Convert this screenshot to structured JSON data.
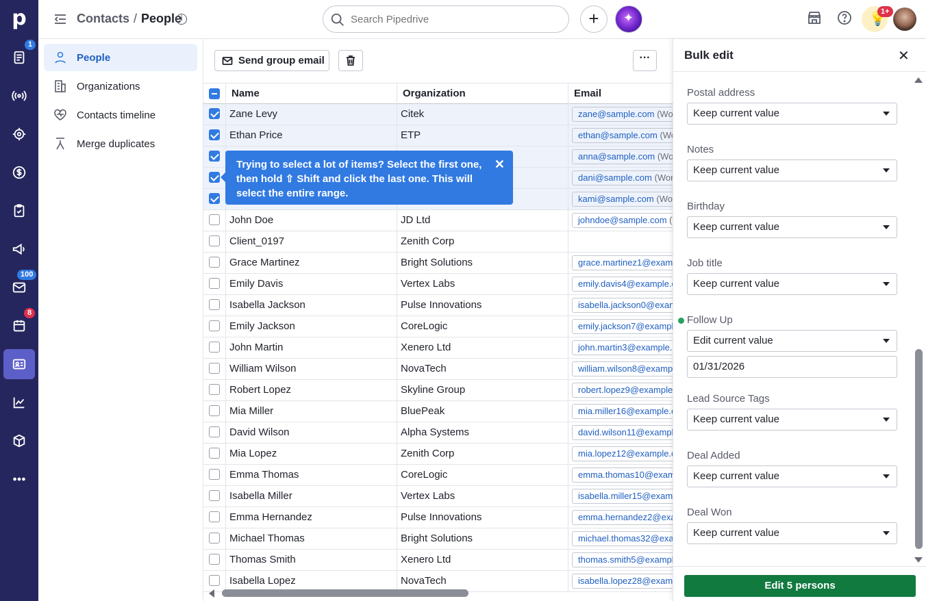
{
  "rail": {
    "logo": "p",
    "badges": {
      "leads": "1",
      "mail": "100",
      "activities": "8"
    }
  },
  "topbar": {
    "breadcrumb_parent": "Contacts",
    "breadcrumb_sep": "/",
    "breadcrumb_current": "People",
    "info_glyph": "i",
    "search_placeholder": "Search Pipedrive",
    "add_glyph": "+",
    "notification_count": "1+"
  },
  "subnav": {
    "items": [
      {
        "label": "People",
        "icon": "person-icon"
      },
      {
        "label": "Organizations",
        "icon": "building-icon"
      },
      {
        "label": "Contacts timeline",
        "icon": "heart-pulse-icon"
      },
      {
        "label": "Merge duplicates",
        "icon": "merge-icon"
      }
    ]
  },
  "toolbar": {
    "send_group_email": "Send group email",
    "more_glyph": "···"
  },
  "table": {
    "columns": [
      "Name",
      "Organization",
      "Email"
    ],
    "rows": [
      {
        "name": "Zane Levy",
        "org": "Citek",
        "email": "zane@sample.com",
        "email_tag": "(Wor",
        "selected": true
      },
      {
        "name": "Ethan Price",
        "org": "ETP",
        "email": "ethan@sample.com",
        "email_tag": "(Wo",
        "selected": true
      },
      {
        "name": "",
        "org": "",
        "email": "anna@sample.com",
        "email_tag": "(Wo",
        "selected": true
      },
      {
        "name": "",
        "org": "",
        "email": "dani@sample.com",
        "email_tag": "(Wor",
        "selected": true
      },
      {
        "name": "",
        "org": "",
        "email": "kami@sample.com",
        "email_tag": "(Wor",
        "selected": true
      },
      {
        "name": "John Doe",
        "org": "JD Ltd",
        "email": "johndoe@sample.com",
        "email_tag": "(V",
        "selected": false
      },
      {
        "name": "Client_0197",
        "org": "Zenith Corp",
        "email": "",
        "email_tag": "",
        "selected": false
      },
      {
        "name": "Grace Martinez",
        "org": "Bright Solutions",
        "email": "grace.martinez1@examp",
        "email_tag": "",
        "selected": false
      },
      {
        "name": "Emily Davis",
        "org": "Vertex Labs",
        "email": "emily.davis4@example.co",
        "email_tag": "",
        "selected": false
      },
      {
        "name": "Isabella Jackson",
        "org": "Pulse Innovations",
        "email": "isabella.jackson0@exam",
        "email_tag": "",
        "selected": false
      },
      {
        "name": "Emily Jackson",
        "org": "CoreLogic",
        "email": "emily.jackson7@example",
        "email_tag": "",
        "selected": false
      },
      {
        "name": "John Martin",
        "org": "Xenero Ltd",
        "email": "john.martin3@example.c",
        "email_tag": "",
        "selected": false
      },
      {
        "name": "William Wilson",
        "org": "NovaTech",
        "email": "william.wilson8@exampl",
        "email_tag": "",
        "selected": false
      },
      {
        "name": "Robert Lopez",
        "org": "Skyline Group",
        "email": "robert.lopez9@example.",
        "email_tag": "",
        "selected": false
      },
      {
        "name": "Mia Miller",
        "org": "BluePeak",
        "email": "mia.miller16@example.co",
        "email_tag": "",
        "selected": false
      },
      {
        "name": "David Wilson",
        "org": "Alpha Systems",
        "email": "david.wilson11@example",
        "email_tag": "",
        "selected": false
      },
      {
        "name": "Mia Lopez",
        "org": "Zenith Corp",
        "email": "mia.lopez12@example.co",
        "email_tag": "",
        "selected": false
      },
      {
        "name": "Emma Thomas",
        "org": "CoreLogic",
        "email": "emma.thomas10@examp",
        "email_tag": "",
        "selected": false
      },
      {
        "name": "Isabella Miller",
        "org": "Vertex Labs",
        "email": "isabella.miller15@examp",
        "email_tag": "",
        "selected": false
      },
      {
        "name": "Emma Hernandez",
        "org": "Pulse Innovations",
        "email": "emma.hernandez2@exa",
        "email_tag": "",
        "selected": false
      },
      {
        "name": "Michael Thomas",
        "org": "Bright Solutions",
        "email": "michael.thomas32@exar",
        "email_tag": "",
        "selected": false
      },
      {
        "name": "Thomas Smith",
        "org": "Xenero Ltd",
        "email": "thomas.smith5@example",
        "email_tag": "",
        "selected": false
      },
      {
        "name": "Isabella Lopez",
        "org": "NovaTech",
        "email": "isabella.lopez28@examp",
        "email_tag": "",
        "selected": false
      }
    ]
  },
  "tooltip": {
    "text": "Trying to select a lot of items? Select the first one, then hold ⇧ Shift and click the last one. This will select the entire range.",
    "close_glyph": "✕"
  },
  "bulk_edit": {
    "title": "Bulk edit",
    "close_glyph": "✕",
    "fields": [
      {
        "label": "Postal address",
        "value": "Keep current value"
      },
      {
        "label": "Notes",
        "value": "Keep current value"
      },
      {
        "label": "Birthday",
        "value": "Keep current value"
      },
      {
        "label": "Job title",
        "value": "Keep current value"
      },
      {
        "label": "Follow Up",
        "value": "Edit current value",
        "date": "01/31/2026",
        "modified": true
      },
      {
        "label": "Lead Source Tags",
        "value": "Keep current value"
      },
      {
        "label": "Deal Added",
        "value": "Keep current value"
      },
      {
        "label": "Deal Won",
        "value": "Keep current value"
      }
    ],
    "submit": "Edit 5 persons"
  },
  "colors": {
    "rail_bg": "#26265e",
    "accent_blue": "#317ae2",
    "submit_green": "#117a3f",
    "badge_red": "#e0314b"
  }
}
